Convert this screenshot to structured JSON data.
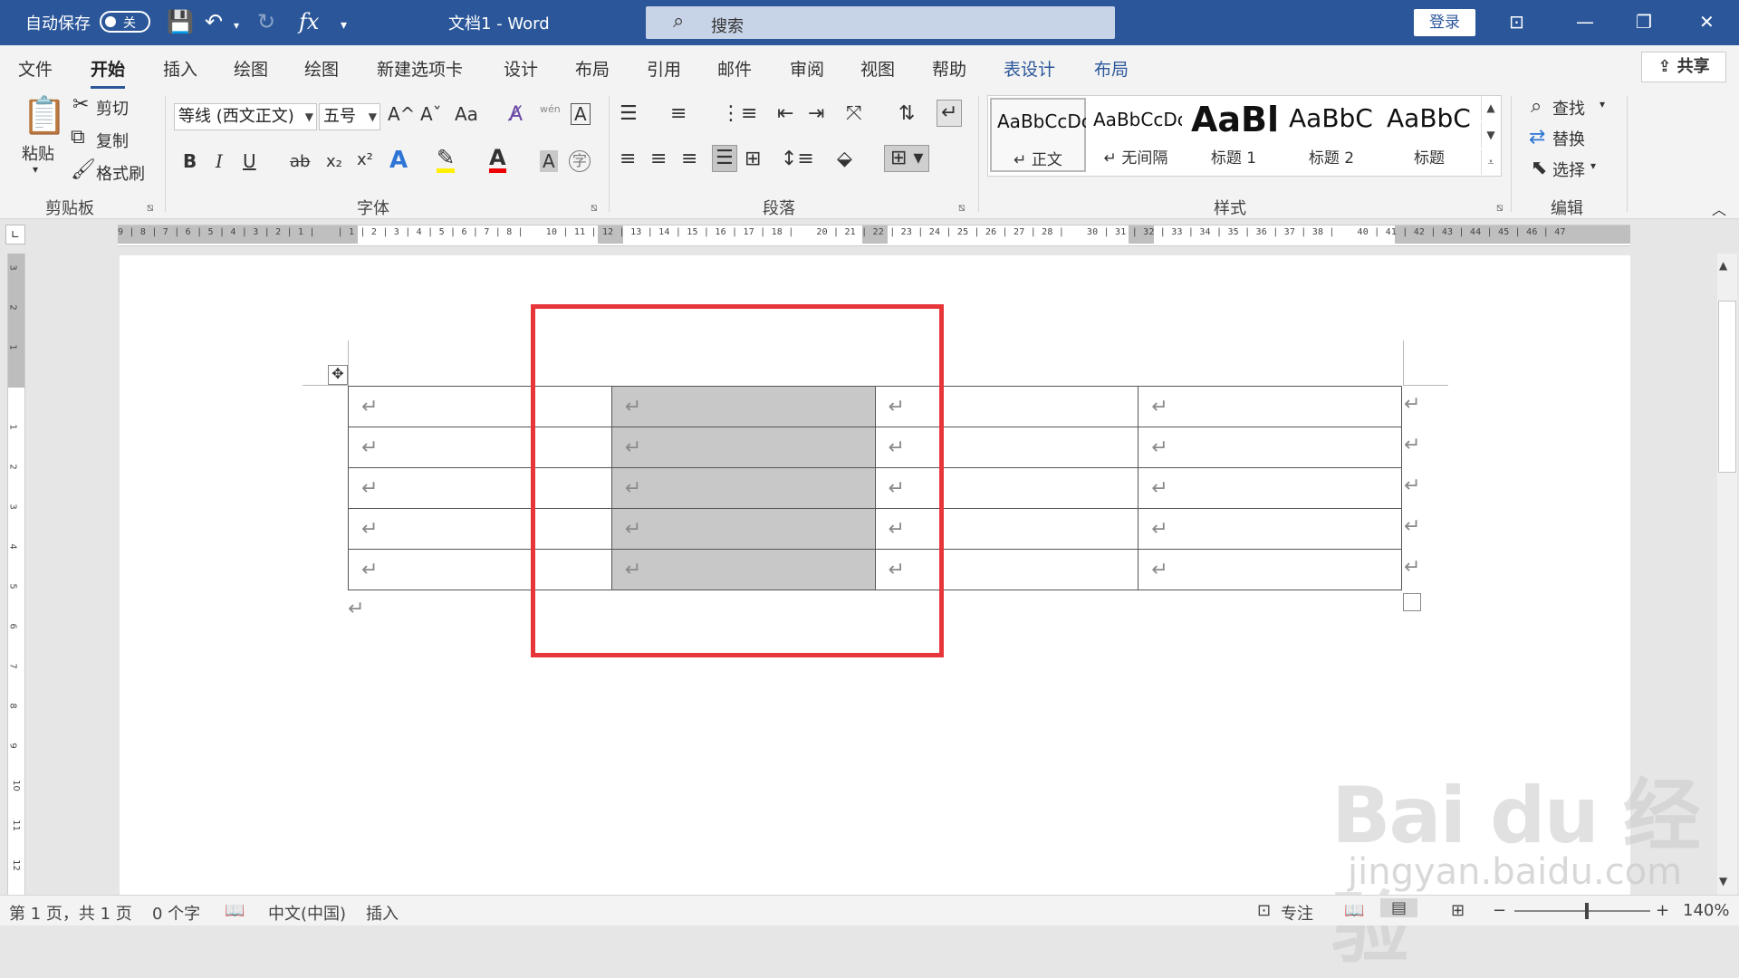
{
  "titlebar": {
    "autosave_label": "自动保存",
    "autosave_state": "关",
    "doc_title": "文档1  -  Word",
    "search_placeholder": "搜索",
    "login": "登录",
    "formula_icon": "fx"
  },
  "tabs": [
    "文件",
    "开始",
    "插入",
    "绘图",
    "绘图",
    "新建选项卡",
    "设计",
    "布局",
    "引用",
    "邮件",
    "审阅",
    "视图",
    "帮助",
    "表设计",
    "布局"
  ],
  "share": "共享",
  "ribbon": {
    "clipboard": {
      "paste": "粘贴",
      "cut": "剪切",
      "copy": "复制",
      "painter": "格式刷",
      "label": "剪贴板"
    },
    "font": {
      "name": "等线 (西文正文)",
      "size": "五号",
      "label": "字体",
      "bold": "B",
      "italic": "I",
      "underline": "U",
      "strike": "ab",
      "sub": "x₂",
      "sup": "x²",
      "char_border": "字",
      "phonetic": "wén",
      "grow": "A^",
      "shrink": "Aˇ",
      "case": "Aa",
      "a_icon": "A"
    },
    "paragraph": {
      "label": "段落"
    },
    "styles": {
      "label": "样式",
      "items": [
        {
          "preview": "AaBbCcDc",
          "name": "↵ 正文"
        },
        {
          "preview": "AaBbCcDc",
          "name": "↵ 无间隔"
        },
        {
          "preview": "AaBl",
          "name": "标题 1"
        },
        {
          "preview": "AaBbC",
          "name": "标题 2"
        },
        {
          "preview": "AaBbC",
          "name": "标题"
        }
      ]
    },
    "editing": {
      "find": "查找",
      "replace": "替换",
      "select": "选择",
      "label": "编辑"
    }
  },
  "ruler": {
    "h_numbers": "9 | 8 | 7 | 6 | 5 | 4 | 3 | 2 | 1 |    | 1 | 2 | 3 | 4 | 5 | 6 | 7 | 8 |    10 | 11 | 12 | 13 | 14 | 15 | 16 | 17 | 18 |    20 | 21 | 22 | 23 | 24 | 25 | 26 | 27 | 28 |    30 | 31 | 32 | 33 | 34 | 35 | 36 | 37 | 38 |    40 | 41 | 42 | 43 | 44 | 45 | 46 | 47",
    "v_numbers": [
      "3",
      "2",
      "1",
      "1",
      "2",
      "3",
      "4",
      "5",
      "6",
      "7",
      "8",
      "9",
      "10",
      "11",
      "12"
    ]
  },
  "table": {
    "rows": 5,
    "cols": 4,
    "cell_mark": "↵",
    "highlighted_col": 1
  },
  "end_mark": "↵",
  "watermark": {
    "brand": "Bai du 经验",
    "url": "jingyan.baidu.com"
  },
  "status": {
    "page": "第 1 页，共 1 页",
    "words": "0 个字",
    "lang": "中文(中国)",
    "mode": "插入",
    "focus": "专注",
    "zoom": "140%",
    "zoom_minus": "−",
    "zoom_plus": "+"
  }
}
